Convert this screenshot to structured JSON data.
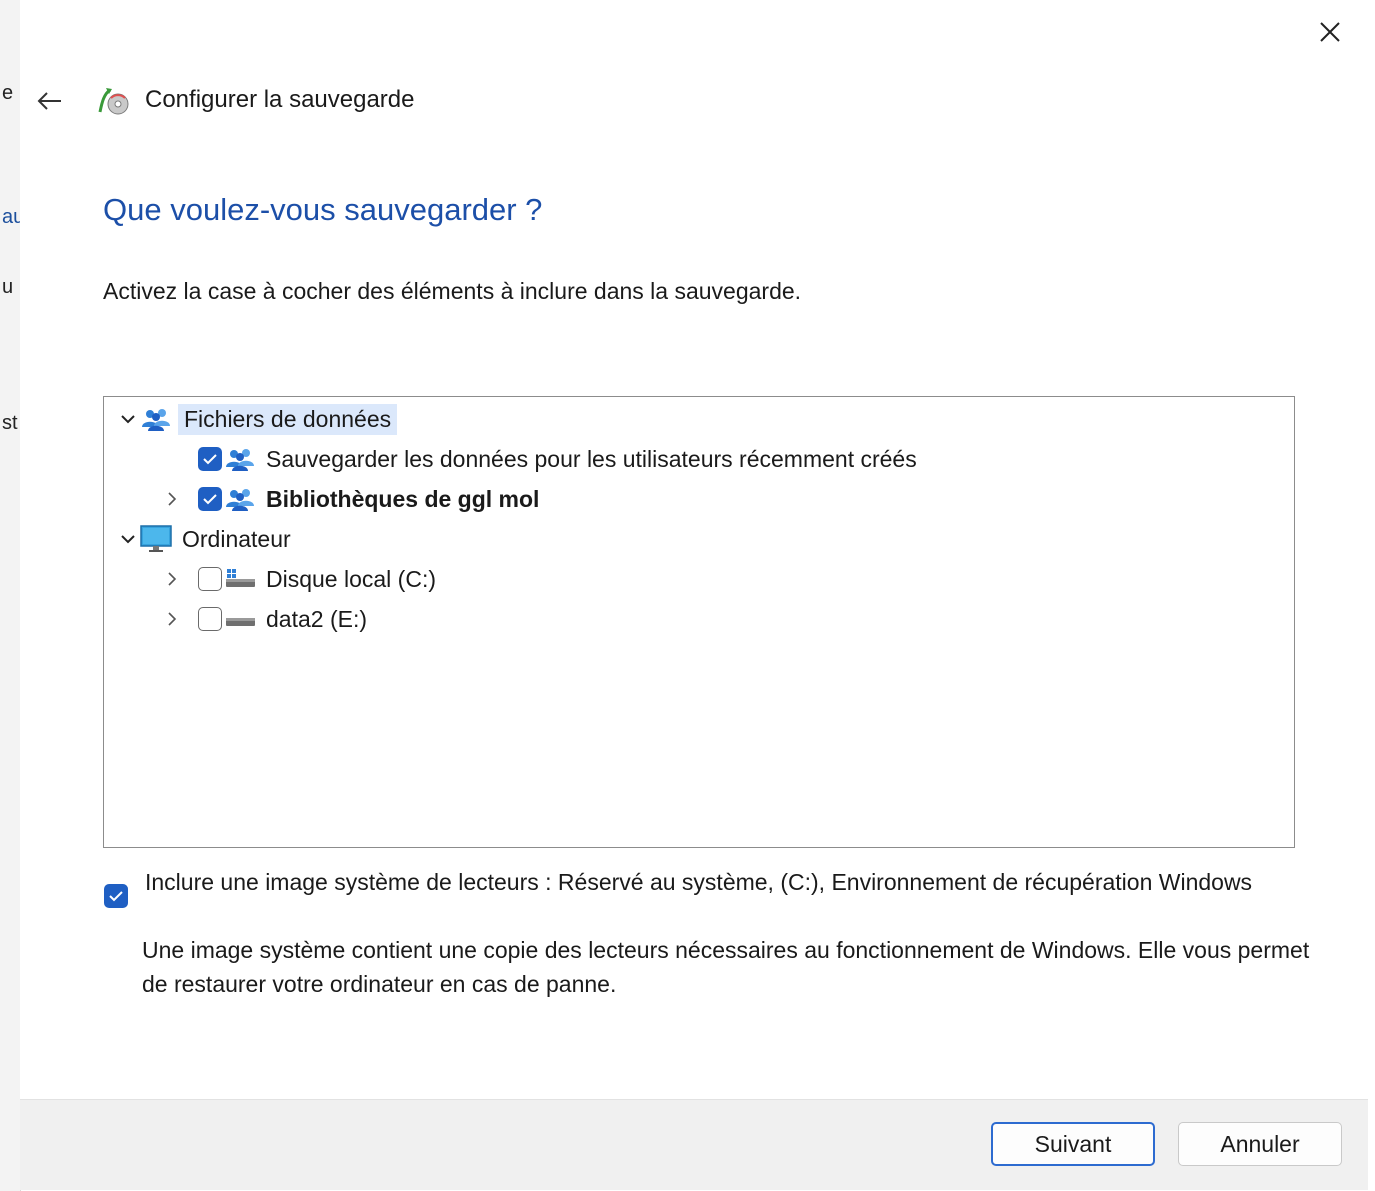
{
  "background_fragments": [
    "e",
    "au",
    "u",
    "st"
  ],
  "window": {
    "title": "Configurer la sauvegarde",
    "heading": "Que voulez-vous sauvegarder ?",
    "instruction": "Activez la case à cocher des éléments à inclure dans la sauvegarde."
  },
  "tree": {
    "data_files": {
      "label": "Fichiers de données",
      "expanded": true,
      "icon": "users-icon",
      "children": {
        "new_users": {
          "label": "Sauvegarder les données pour les utilisateurs récemment créés",
          "checked": true
        },
        "libraries": {
          "label": "Bibliothèques de ggl mol",
          "checked": true
        }
      }
    },
    "computer": {
      "label": "Ordinateur",
      "expanded": true,
      "icon": "monitor-icon",
      "children": {
        "drive_c": {
          "label": "Disque local (C:)",
          "checked": false
        },
        "drive_e": {
          "label": "data2 (E:)",
          "checked": false
        }
      }
    }
  },
  "system_image": {
    "checked": true,
    "label": "Inclure une image système de lecteurs : Réservé au système, (C:), Environnement de récupération Windows",
    "description": "Une image système contient une copie des lecteurs nécessaires au fonctionnement de Windows. Elle vous permet de restaurer votre ordinateur en cas de panne."
  },
  "buttons": {
    "next": "Suivant",
    "cancel": "Annuler"
  },
  "colors": {
    "accent": "#1f5fc3",
    "heading": "#1c4fa8",
    "selection": "#dbe8fb"
  }
}
